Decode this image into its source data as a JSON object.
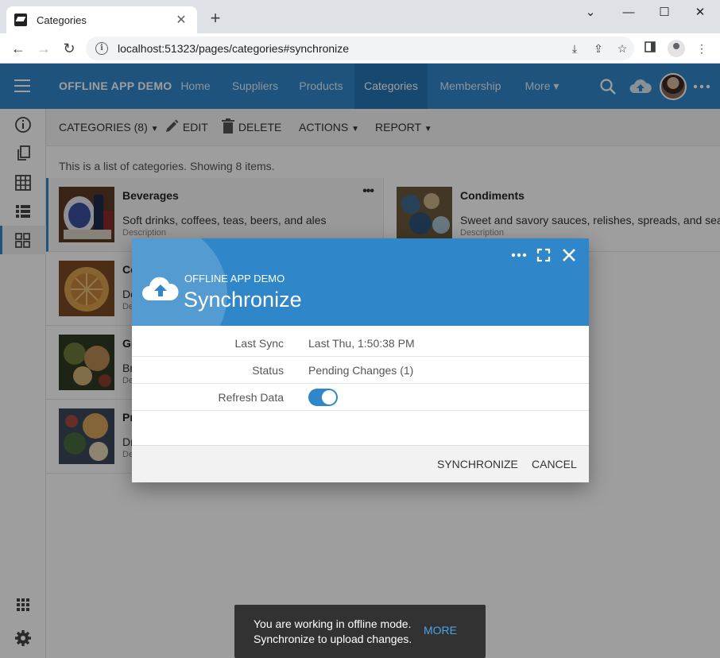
{
  "browser": {
    "tab_title": "Categories",
    "tab_close": "✕",
    "new_tab": "+",
    "url": "localhost:51323/pages/categories#synchronize"
  },
  "app": {
    "brand": "OFFLINE APP DEMO",
    "nav": [
      "Home",
      "Suppliers",
      "Products",
      "Categories",
      "Membership",
      "More ▾"
    ],
    "active_nav": "Categories"
  },
  "toolbar": {
    "categories": "CATEGORIES (8)",
    "edit": "EDIT",
    "delete": "DELETE",
    "actions": "ACTIONS",
    "report": "REPORT"
  },
  "list": {
    "description": "This is a list of categories. Showing 8 items.",
    "field_label": "Description",
    "cards": [
      {
        "title": "Beverages",
        "text": "Soft drinks, coffees, teas, beers, and ales",
        "label": "Description"
      },
      {
        "title": "Condiments",
        "text": "Sweet and savory sauces, relishes, spreads, and seaso",
        "label": "Description"
      },
      {
        "title": "Co",
        "text": "De",
        "label": "De"
      },
      {
        "title": "Gr",
        "text": "Br",
        "label": "De"
      },
      {
        "title": "Pr",
        "text": "Dr",
        "label": "De"
      }
    ]
  },
  "dialog": {
    "app_name": "OFFLINE APP DEMO",
    "title": "Synchronize",
    "rows": [
      {
        "label": "Last Sync",
        "value": "Last Thu, 1:50:38 PM"
      },
      {
        "label": "Status",
        "value": "Pending Changes (1)"
      },
      {
        "label": "Refresh Data",
        "toggle": true
      }
    ],
    "synchronize": "SYNCHRONIZE",
    "cancel": "CANCEL"
  },
  "snackbar": {
    "line1": "You are working in offline mode.",
    "line2": "Synchronize to upload changes.",
    "action": "MORE"
  },
  "colors": {
    "accent": "#2f86c8",
    "snackbar_bg": "#323232",
    "snackbar_action": "#4aa3e8"
  }
}
